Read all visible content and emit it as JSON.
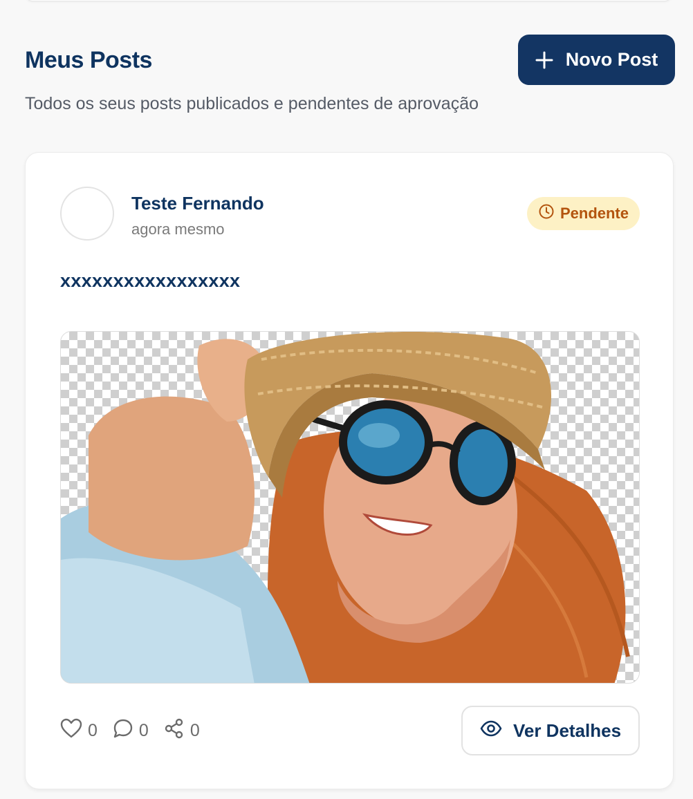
{
  "header": {
    "title": "Meus Posts",
    "subtitle": "Todos os seus posts publicados e pendentes de aprovação",
    "new_post_label": "Novo Post"
  },
  "post": {
    "author": "Teste Fernando",
    "time": "agora mesmo",
    "status": "Pendente",
    "text": "xxxxxxxxxxxxxxxxx",
    "likes": "0",
    "comments": "0",
    "shares": "0",
    "details_label": "Ver Detalhes"
  },
  "colors": {
    "primary": "#133563",
    "badge_bg": "#fdf1c5",
    "badge_text": "#b3540e"
  },
  "icons": [
    "plus-icon",
    "clock-icon",
    "heart-icon",
    "comment-icon",
    "share-icon",
    "eye-icon"
  ]
}
